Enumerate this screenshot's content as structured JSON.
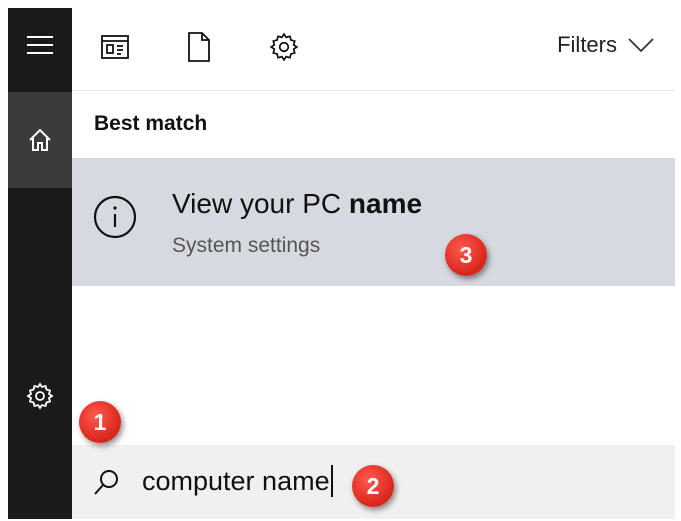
{
  "toolbar": {
    "icons": [
      "apps-icon",
      "documents-icon",
      "settings-icon"
    ],
    "filters_label": "Filters"
  },
  "rail": {
    "icons": [
      "hamburger-menu-icon",
      "home-icon",
      "settings-gear-icon"
    ]
  },
  "results": {
    "heading": "Best match",
    "items": [
      {
        "icon": "info-icon",
        "title_prefix": "View your PC ",
        "title_bold": "name",
        "subtitle": "System settings"
      }
    ]
  },
  "search": {
    "value": "computer name"
  },
  "badges": [
    "1",
    "2",
    "3"
  ],
  "colors": {
    "rail_bg": "#1a1a1a",
    "rail_active": "#3b3b3b",
    "result_highlight": "#d6dae0",
    "badge_red": "#d9251a"
  }
}
